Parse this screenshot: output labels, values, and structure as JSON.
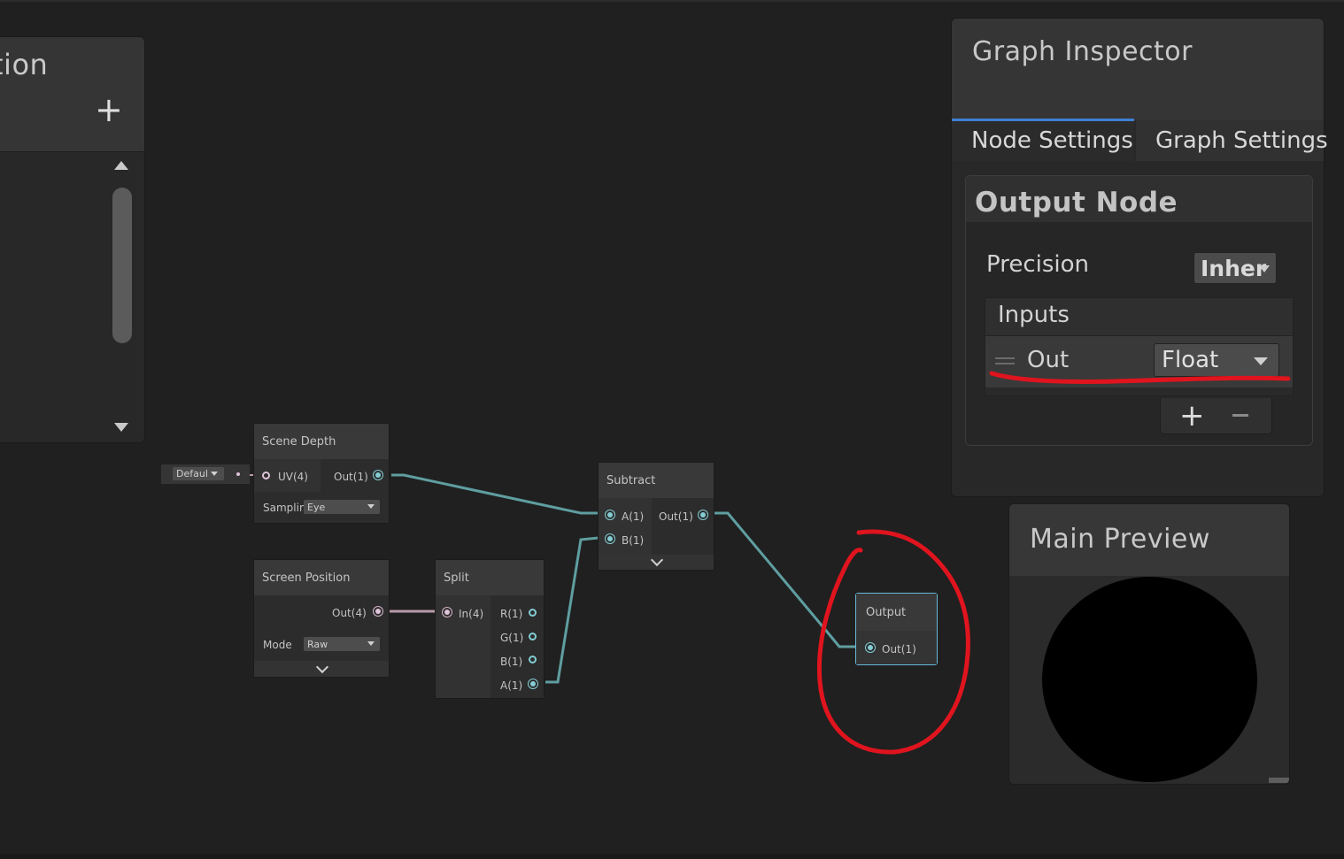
{
  "blackboard": {
    "title": "tion",
    "add_icon": "plus-icon"
  },
  "graph": {
    "scene_depth": {
      "title": "Scene Depth",
      "uv_port": "UV(4)",
      "out_port": "Out(1)",
      "sampling_label": "Samplin",
      "sampling_value": "Eye",
      "uv_default": "Defaul"
    },
    "screen_position": {
      "title": "Screen Position",
      "out_port": "Out(4)",
      "mode_label": "Mode",
      "mode_value": "Raw"
    },
    "split": {
      "title": "Split",
      "in_port": "In(4)",
      "r_port": "R(1)",
      "g_port": "G(1)",
      "b_port": "B(1)",
      "a_port": "A(1)"
    },
    "subtract": {
      "title": "Subtract",
      "a_port": "A(1)",
      "b_port": "B(1)",
      "out_port": "Out(1)"
    },
    "output": {
      "title": "Output",
      "out_port": "Out(1)"
    }
  },
  "inspector": {
    "title": "Graph Inspector",
    "tabs": [
      {
        "label": "Node Settings",
        "active": true
      },
      {
        "label": "Graph Settings",
        "active": false
      }
    ],
    "node_title": "Output Node",
    "precision_label": "Precision",
    "precision_value": "Inher",
    "inputs_label": "Inputs",
    "input_rows": [
      {
        "name": "Out",
        "type": "Float"
      }
    ]
  },
  "preview": {
    "title": "Main Preview"
  },
  "colors": {
    "edge_float": "#5f9ea0",
    "edge_vector": "#b89aaa",
    "annotation": "#e0141e",
    "tab_accent": "#3e7fd4"
  }
}
